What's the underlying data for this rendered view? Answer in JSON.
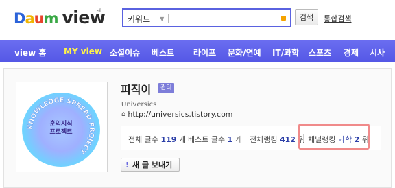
{
  "header": {
    "logo_daum": [
      "D",
      "a",
      "u",
      "m"
    ],
    "logo_view": "view",
    "search": {
      "select_label": "키워드",
      "input_value": ""
    },
    "search_button": "검색",
    "integrated_search": "통합검색"
  },
  "nav": {
    "items": [
      {
        "label": "view 홈",
        "active": false
      },
      {
        "label": "MY view",
        "active": true
      },
      {
        "label": "소셜이슈",
        "active": false
      },
      {
        "label": "베스트",
        "active": false
      },
      {
        "label": "라이프",
        "active": false
      },
      {
        "label": "문화/연예",
        "active": false
      },
      {
        "label": "IT/과학",
        "active": false
      },
      {
        "label": "스포츠",
        "active": false
      },
      {
        "label": "경제",
        "active": false
      },
      {
        "label": "시사",
        "active": false
      }
    ]
  },
  "profile": {
    "image_center_line1": "훈익지식",
    "image_center_line2": "프로젝트",
    "image_ring_text": "KNOWLEDGE SPREAD PROJECT",
    "blog_name": "피직이",
    "admin_badge": "관리",
    "sub_label": "Universics",
    "url": "http://universics.tistory.com"
  },
  "stats": {
    "total_posts_label": "전체 글수",
    "total_posts_value": "119",
    "total_posts_unit": "개",
    "best_posts_label": "베스트 글수",
    "best_posts_value": "1",
    "best_posts_unit": "개",
    "total_rank_label": "전체랭킹",
    "total_rank_value": "412",
    "total_rank_unit": "위",
    "channel_rank_label": "채널랭킹",
    "channel_rank_field": "과학",
    "channel_rank_value": "2",
    "channel_rank_unit": "위"
  },
  "send_button": {
    "icon": "!",
    "label": "새 글 보내기"
  },
  "colors": {
    "nav_bg": "#5e61ea",
    "nav_active": "#fff34a",
    "search_border": "#5a62e0",
    "highlight": "#f08a8a",
    "admin_badge": "#7d7dd9"
  }
}
